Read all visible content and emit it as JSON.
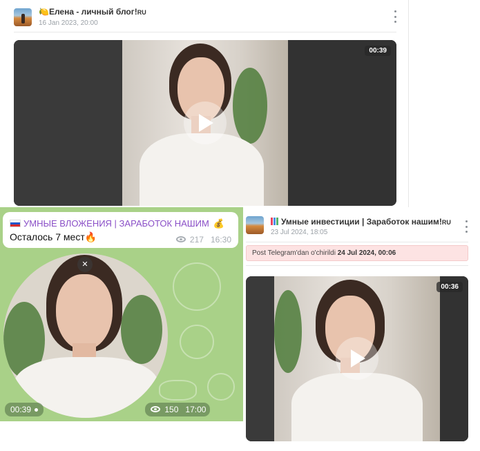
{
  "post1": {
    "channel_title": "Елена - личный блог!",
    "channel_suffix": "RU",
    "channel_emoji": "🍋",
    "date": "16 Jan 2023, 20:00",
    "video_duration": "00:39"
  },
  "telegram_card": {
    "channel_name": "УМНЫЕ ВЛОЖЕНИЯ | ЗАРАБОТОК НАШИМ",
    "channel_flag": "🇷🇺",
    "channel_end_emoji": "💰",
    "message_text": "Осталось 7 мест",
    "message_emoji": "🔥",
    "views": "217",
    "time": "16:30",
    "circle_duration": "00:39",
    "circle_views": "150",
    "circle_time": "17:00",
    "background_color": "#a9d188"
  },
  "post2": {
    "channel_title": "Умные инвестиции | Заработок нашим!",
    "channel_suffix": "RU",
    "date": "23 Jul 2024, 18:05",
    "deleted_notice": "Post Telegram'dan o'chirildi",
    "deleted_date": "24 Jul 2024, 00:06",
    "video_duration": "00:36"
  },
  "icons": {
    "kebab": "more-vertical-icon",
    "play": "play-icon",
    "mute": "mute-icon",
    "views": "eye-icon"
  },
  "colors": {
    "channel_purple": "#8a4fc7",
    "deleted_bg": "#fde3e3",
    "meta_gray": "#9aa0a6"
  }
}
